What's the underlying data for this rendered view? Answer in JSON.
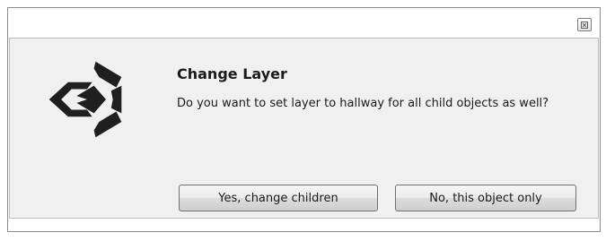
{
  "dialog": {
    "title": "Change Layer",
    "message": "Do you want to set layer to hallway for all child objects as well?",
    "close_icon": "close-icon",
    "logo_icon": "unity-logo-icon",
    "buttons": {
      "yes_label": "Yes, change children",
      "no_label": "No, this object only"
    }
  },
  "colors": {
    "client_background": "#f0f0f0",
    "logo": "#1f1f1f",
    "button_border": "#707070"
  }
}
